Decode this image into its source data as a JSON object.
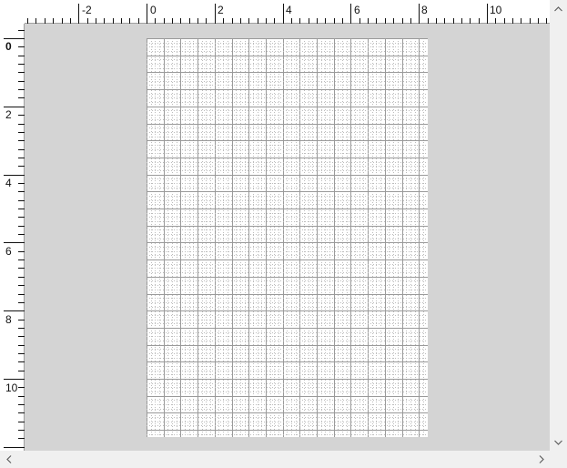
{
  "ruler": {
    "horizontal_labels": [
      "-2",
      "0",
      "2",
      "4",
      "6",
      "8",
      "10"
    ],
    "vertical_labels": [
      "0",
      "2",
      "4",
      "6",
      "8",
      "10"
    ]
  },
  "page": {
    "grid": "on"
  },
  "scrollbars": {
    "vertical": [
      "scroll-up-arrow-icon",
      "scroll-down-arrow-icon"
    ],
    "horizontal": [
      "scroll-left-arrow-icon",
      "scroll-right-arrow-icon"
    ]
  },
  "colors": {
    "workspace": "#d4d4d4",
    "page": "#ffffff",
    "grid_major": "#9a9a9a",
    "grid_minor": "#bdbdbd",
    "scrollbar": "#f0f0f0"
  }
}
